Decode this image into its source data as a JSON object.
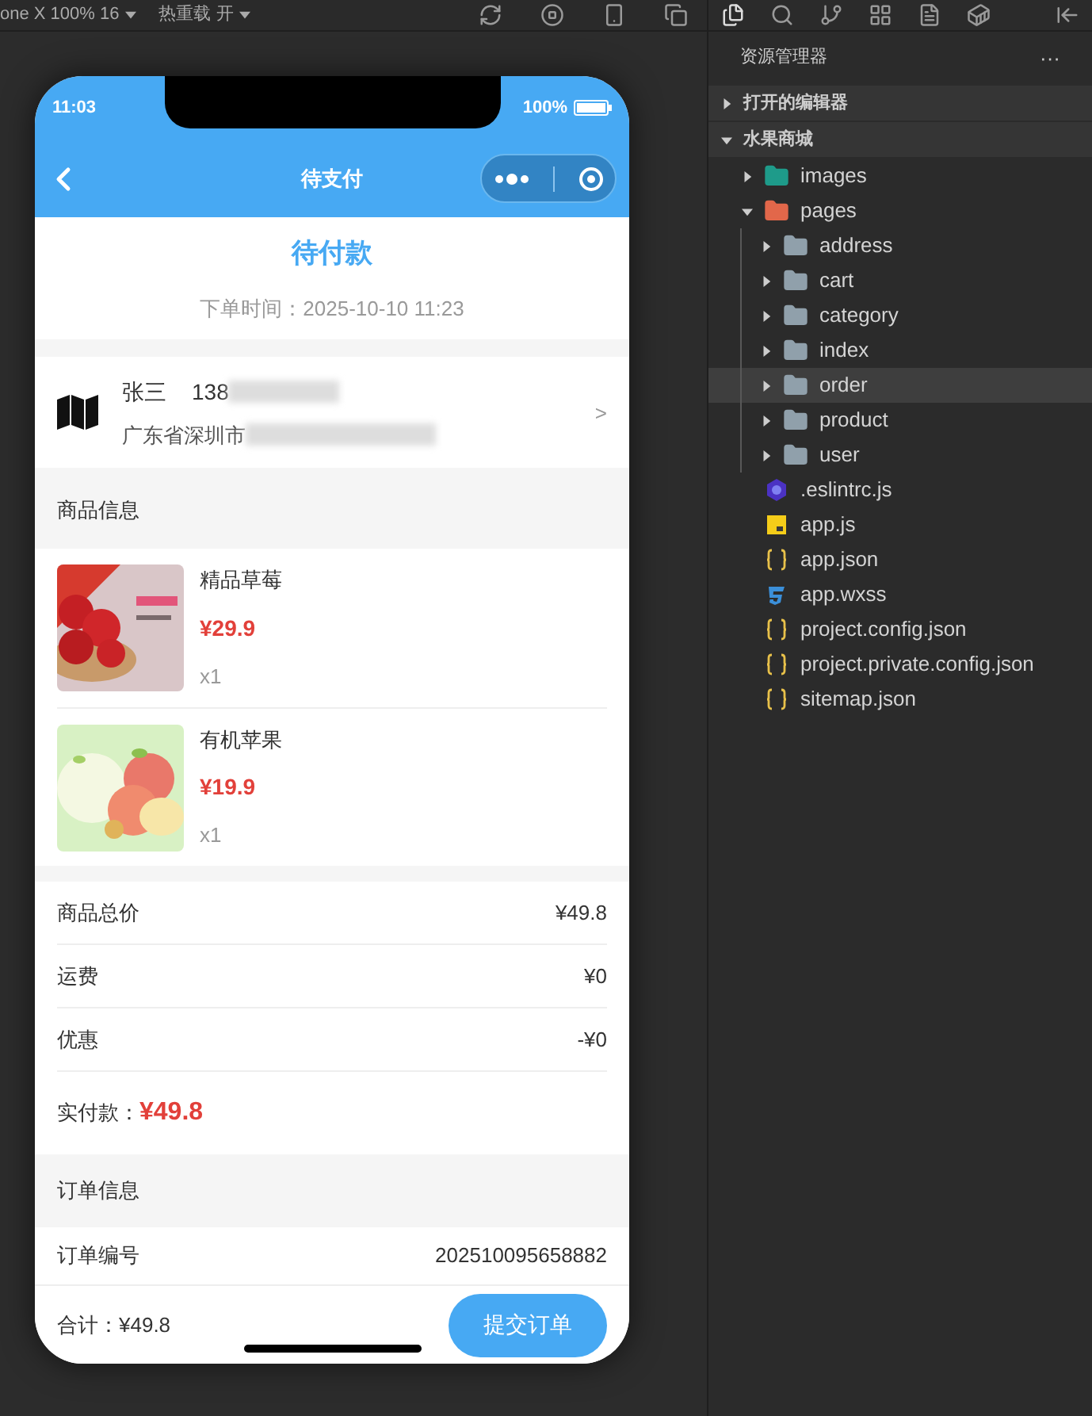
{
  "toolbar": {
    "device": "one X 100% 16",
    "hot_reload": "热重载 开"
  },
  "phone": {
    "status_bar": {
      "time": "11:03",
      "battery": "100%"
    },
    "nav": {
      "title": "待支付"
    },
    "order_status": {
      "title": "待付款",
      "time": "下单时间：2025-10-10 11:23"
    },
    "address": {
      "name": "张三",
      "phone": "138",
      "address": "广东省深圳市",
      "arrow": ">"
    },
    "goods": {
      "title": "商品信息",
      "items": [
        {
          "name": "精品草莓",
          "price": "¥29.9",
          "qty": "x1",
          "kind": "strawberry"
        },
        {
          "name": "有机苹果",
          "price": "¥19.9",
          "qty": "x1",
          "kind": "apple"
        }
      ]
    },
    "summary": {
      "rows": [
        {
          "label": "商品总价",
          "value": "¥49.8"
        },
        {
          "label": "运费",
          "value": "¥0"
        },
        {
          "label": "优惠",
          "value": "-¥0"
        }
      ],
      "paid_label": "实付款：",
      "paid_value": "¥49.8"
    },
    "order_info": {
      "title": "订单信息",
      "rows": [
        {
          "label": "订单编号",
          "value": "202510095658882"
        }
      ]
    },
    "bottom_bar": {
      "total": "合计：¥49.8",
      "button": "提交订单"
    }
  },
  "explorer": {
    "title": "资源管理器",
    "more": "···",
    "sections": [
      {
        "label": "打开的编辑器",
        "expanded": false
      },
      {
        "label": "水果商城",
        "expanded": true
      }
    ],
    "tree": [
      {
        "name": "images",
        "kind": "imagefolder",
        "expanded": false
      },
      {
        "name": "pages",
        "kind": "codefolder",
        "expanded": true,
        "children": [
          {
            "name": "address",
            "kind": "folder",
            "expanded": false,
            "selected": false
          },
          {
            "name": "cart",
            "kind": "folder",
            "expanded": false,
            "selected": false
          },
          {
            "name": "category",
            "kind": "folder",
            "expanded": false,
            "selected": false
          },
          {
            "name": "index",
            "kind": "folder",
            "expanded": false,
            "selected": false
          },
          {
            "name": "order",
            "kind": "folder",
            "expanded": false,
            "selected": true
          },
          {
            "name": "product",
            "kind": "folder",
            "expanded": false,
            "selected": false
          },
          {
            "name": "user",
            "kind": "folder",
            "expanded": false,
            "selected": false
          }
        ]
      },
      {
        "name": ".eslintrc.js",
        "kind": "eslint"
      },
      {
        "name": "app.js",
        "kind": "js"
      },
      {
        "name": "app.json",
        "kind": "json"
      },
      {
        "name": "app.wxss",
        "kind": "css"
      },
      {
        "name": "project.config.json",
        "kind": "json"
      },
      {
        "name": "project.private.config.json",
        "kind": "json"
      },
      {
        "name": "sitemap.json",
        "kind": "json"
      }
    ]
  }
}
